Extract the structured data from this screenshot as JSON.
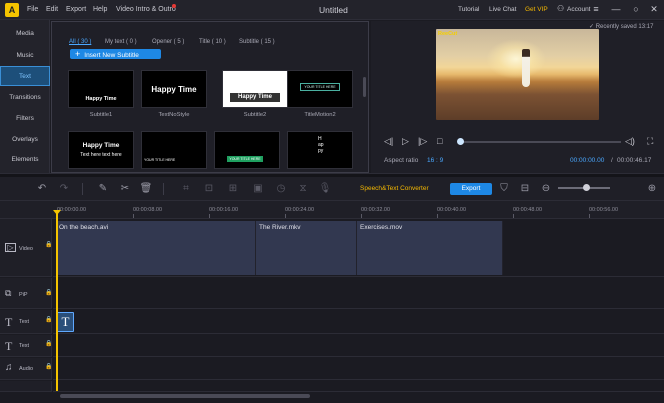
{
  "app": {
    "title": "Untitled",
    "menu": [
      "File",
      "Edit",
      "Export",
      "Help",
      "Video Intro & Outro"
    ],
    "links": {
      "tutorial": "Tutorial",
      "live_chat": "Live Chat",
      "vip": "Get VIP",
      "account": "Account"
    },
    "window_controls": [
      "≡",
      "—",
      "○",
      "✕"
    ],
    "logo_glyph": "A"
  },
  "left_nav": {
    "items": [
      "Media",
      "Music",
      "Text",
      "Transitions",
      "Filters",
      "Overlays",
      "Elements"
    ],
    "active": "Text"
  },
  "library": {
    "filters": [
      {
        "label": "All ( 30 )",
        "active": true
      },
      {
        "label": "My text ( 0 )",
        "active": false
      },
      {
        "label": "Opener ( 5 )",
        "active": false
      },
      {
        "label": "Title ( 10 )",
        "active": false
      },
      {
        "label": "Subtitle ( 15 )",
        "active": false
      }
    ],
    "insert_button": "Insert New Subtitle",
    "items": [
      {
        "name": "Subtitle1",
        "preview": "Happy Time"
      },
      {
        "name": "TextNoStyle",
        "preview": "Happy Time"
      },
      {
        "name": "Subtitle2",
        "preview": "Happy Time"
      },
      {
        "name": "TitleMotion2",
        "preview": "YOUR TITLE HERE"
      }
    ],
    "row2": [
      {
        "preview": "Happy Time",
        "sub": "Text here text here"
      },
      {
        "preview": "YOUR TITLE HERE"
      },
      {
        "preview": "YOUR TITLE HERE"
      },
      {
        "preview": "Happy"
      }
    ]
  },
  "preview": {
    "recently_saved": "Recently saved 13:17",
    "watermark": "ReeCut",
    "aspect_label": "Aspect ratio",
    "aspect_value": "16 : 9",
    "current_time": "00:00:00.00",
    "separator": "/",
    "total_time": "00:00:46.17"
  },
  "toolbar": {
    "speech_text": "Speech&Text Converter",
    "export": "Export"
  },
  "timeline": {
    "ruler": [
      "00:00:00.00",
      "00:00:08.00",
      "00:00:16.00",
      "00:00:24.00",
      "00:00:32.00",
      "00:00:40.00",
      "00:00:48.00",
      "00:00:56.00"
    ],
    "tracks": [
      {
        "label": "Video",
        "icon": "video-icon"
      },
      {
        "label": "PiP",
        "icon": "pip-icon"
      },
      {
        "label": "Text",
        "icon": "text-icon"
      },
      {
        "label": "Text",
        "icon": "text-icon"
      },
      {
        "label": "Audio",
        "icon": "audio-icon"
      }
    ],
    "clips": [
      {
        "name": "On the beach.avi"
      },
      {
        "name": "The River.mkv"
      },
      {
        "name": "Exercises.mov"
      }
    ],
    "text_clip_glyph": "T"
  }
}
